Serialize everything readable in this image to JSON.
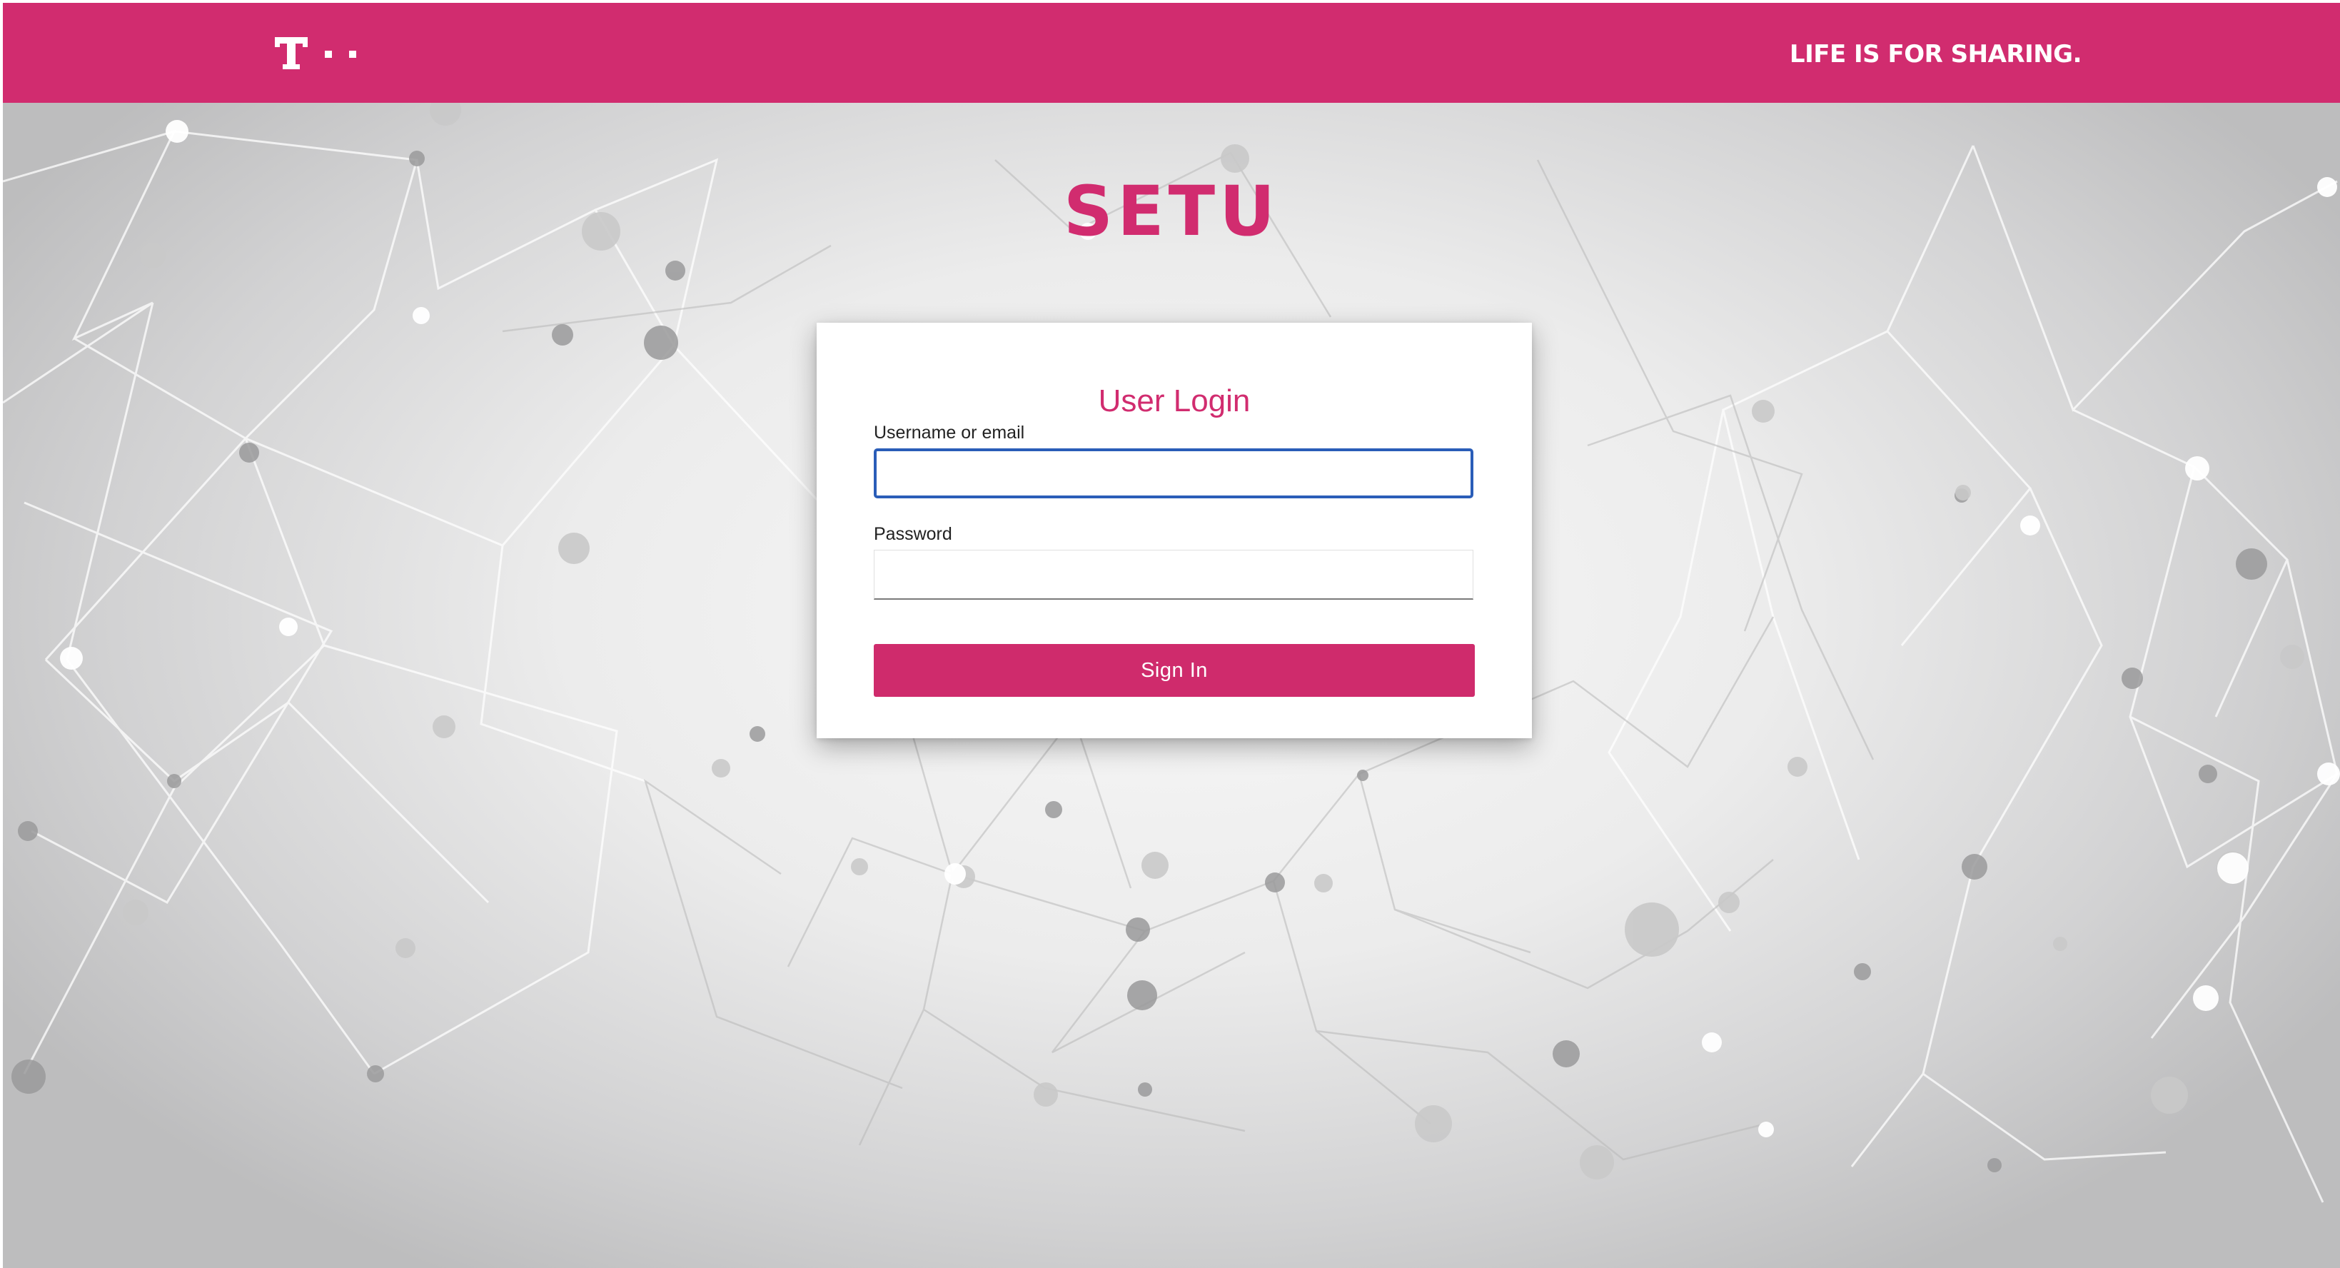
{
  "header": {
    "logo_alt": "T · ·",
    "tagline": "LIFE IS FOR SHARING."
  },
  "app": {
    "title": "SETU"
  },
  "login": {
    "title": "User Login",
    "username_label": "Username or email",
    "username_value": "",
    "password_label": "Password",
    "password_value": "",
    "submit_label": "Sign In"
  },
  "colors": {
    "brand": "#d12c6f",
    "focus_border": "#2a5db8",
    "background_center": "#f7f7f7",
    "background_edge": "#bdbdbe"
  }
}
